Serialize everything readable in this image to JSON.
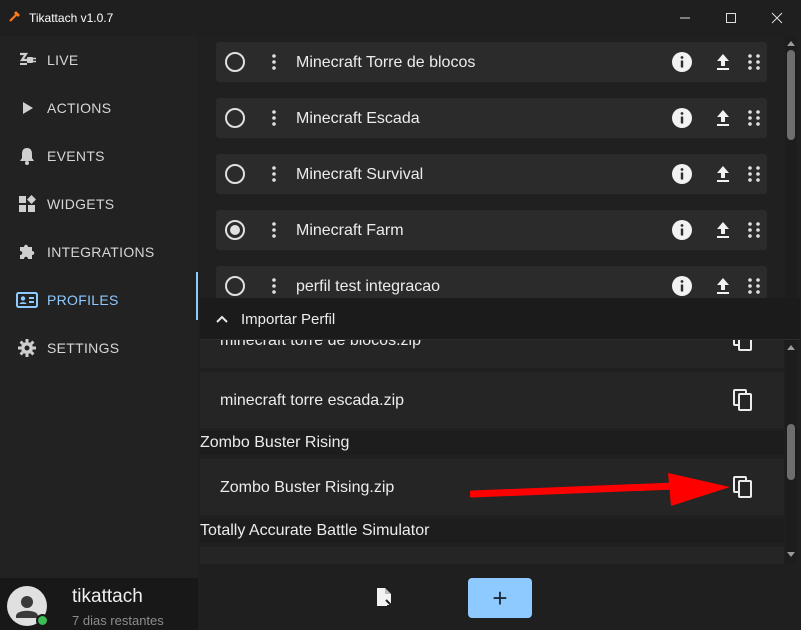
{
  "window": {
    "title": "Tikattach v1.0.7",
    "icon": "tikattach-logo-icon",
    "controls": [
      "minimize-icon",
      "maximize-icon",
      "close-icon"
    ]
  },
  "sidebar": {
    "items": [
      {
        "label": "LIVE",
        "icon": "live-plug-icon"
      },
      {
        "label": "ACTIONS",
        "icon": "play-icon"
      },
      {
        "label": "EVENTS",
        "icon": "bell-icon"
      },
      {
        "label": "WIDGETS",
        "icon": "widgets-icon"
      },
      {
        "label": "INTEGRATIONS",
        "icon": "puzzle-icon"
      },
      {
        "label": "PROFILES",
        "icon": "profile-card-icon",
        "active": true
      },
      {
        "label": "SETTINGS",
        "icon": "gear-icon"
      }
    ],
    "user": {
      "name": "tikattach",
      "subtitle": "7 dias restantes",
      "status_color": "#3dbd55"
    }
  },
  "profiles": [
    {
      "name": "Minecraft Torre de blocos",
      "selected": false
    },
    {
      "name": "Minecraft Escada",
      "selected": false
    },
    {
      "name": "Minecraft Survival",
      "selected": false
    },
    {
      "name": "Minecraft Farm",
      "selected": true
    },
    {
      "name": "perfil test integracao",
      "selected": false
    }
  ],
  "import_panel": {
    "title": "Importar Perfil",
    "partial_file": "minecraft torre de blocos.zip",
    "files": [
      {
        "name": "minecraft torre escada.zip"
      }
    ],
    "groups": [
      {
        "title": "Zombo Buster Rising",
        "files": [
          {
            "name": "Zombo Buster Rising.zip"
          }
        ]
      },
      {
        "title": "Totally Accurate Battle Simulator",
        "files": []
      }
    ]
  },
  "bottom_bar": {
    "add_label": "+",
    "import_icon": "file-import-icon"
  },
  "colors": {
    "accent": "#8ec9ff",
    "annotation_arrow": "#ff0000"
  }
}
